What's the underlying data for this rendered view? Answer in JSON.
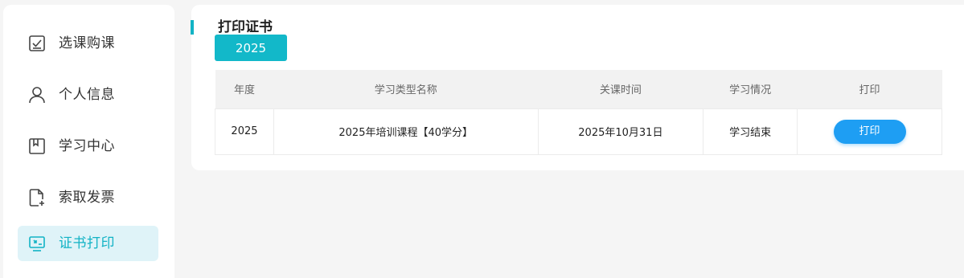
{
  "sidebar": {
    "items": [
      {
        "label": "选课购课",
        "icon": "checkbox-icon",
        "active": false
      },
      {
        "label": "个人信息",
        "icon": "user-icon",
        "active": false
      },
      {
        "label": "学习中心",
        "icon": "book-icon",
        "active": false
      },
      {
        "label": "索取发票",
        "icon": "invoice-icon",
        "active": false
      },
      {
        "label": "证书打印",
        "icon": "certificate-icon",
        "active": true
      }
    ]
  },
  "main": {
    "title": "打印证书",
    "year_tab": "2025",
    "table": {
      "headers": [
        "年度",
        "学习类型名称",
        "关课时间",
        "学习情况",
        "打印"
      ],
      "rows": [
        {
          "year": "2025",
          "name": "2025年培训课程【40学分】",
          "close_time": "2025年10月31日",
          "status": "学习结束",
          "action": "打印"
        }
      ]
    }
  },
  "colors": {
    "accent": "#12b3c5",
    "active_bg": "#dff3f8",
    "button": "#1e9ef3",
    "status_link": "#1e8ed6"
  }
}
